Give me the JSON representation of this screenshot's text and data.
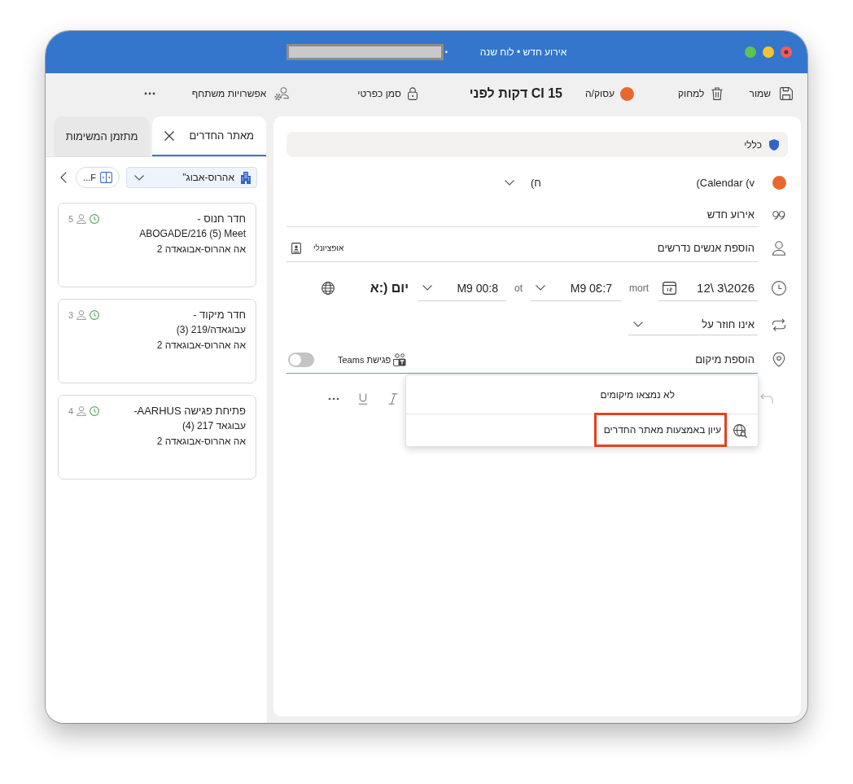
{
  "window": {
    "separator": "•",
    "title": "אירוע חדש • לוח שנה"
  },
  "toolbar": {
    "items": [
      {
        "kind": "save",
        "label": "שמור"
      },
      {
        "kind": "delete",
        "label": "למחוק"
      },
      {
        "kind": "status",
        "label": "עסוק/ה"
      },
      {
        "kind": "reminder",
        "label": "15 CI דקות לפני"
      },
      {
        "kind": "private",
        "label": "סמן כפרטי"
      },
      {
        "kind": "attendee_options",
        "label": "אפשרויות משתחף"
      },
      {
        "kind": "more"
      }
    ]
  },
  "form": {
    "category": {
      "label": "כללי"
    },
    "calendar": {
      "name": "(Calendar (v",
      "account": "(ח"
    },
    "title": {
      "value": "אירוע חדש"
    },
    "attendees": {
      "placeholder": "הוספת אנשים נדרשים",
      "optional": "אופציונלי"
    },
    "time": {
      "date": "12\\ 3\\2026",
      "from_label": "mort",
      "start": "M9 0Ɛ:7",
      "to_label": "ot",
      "end": "M9 00:8",
      "timezone": "יום (:א"
    },
    "repeat": {
      "value": "אינו חוזר על"
    },
    "location": {
      "placeholder": "הוספת מיקום",
      "teams_label": "פגישת Teams",
      "teams_on": false
    },
    "location_menu": {
      "empty_text": "לא נמצאו מיקומים",
      "items": [
        {
          "label": "עיון באמצעות מאתר החדרים",
          "highlighted": true
        }
      ]
    }
  },
  "sidebar": {
    "tabs": [
      {
        "label": "מאתר החדרים",
        "selected": true,
        "closable": true
      },
      {
        "label": "מתזמן המשימות",
        "selected": false,
        "closable": false
      }
    ],
    "building_filter": {
      "value": "אהרוס-אבוג\""
    },
    "filter_button": {
      "label": "F..."
    },
    "rooms": [
      {
        "name": "חדר חנוס -",
        "detail": "ABOGADE/216 (5) Meet",
        "address": "אה אהרוס-אבוגאדה 2",
        "capacity": "5"
      },
      {
        "name": "חדר מיקוד -",
        "detail": "עבוגאדה/219 (3)",
        "address": "אה  אהרוס-אבוגאדה 2",
        "capacity": "3"
      },
      {
        "name": "פתיחת פגישה AARHUS-",
        "detail": "עבוגאד 217 (4)",
        "address": "אה אהרוס-אבוגאדה 2",
        "capacity": "4"
      }
    ]
  }
}
